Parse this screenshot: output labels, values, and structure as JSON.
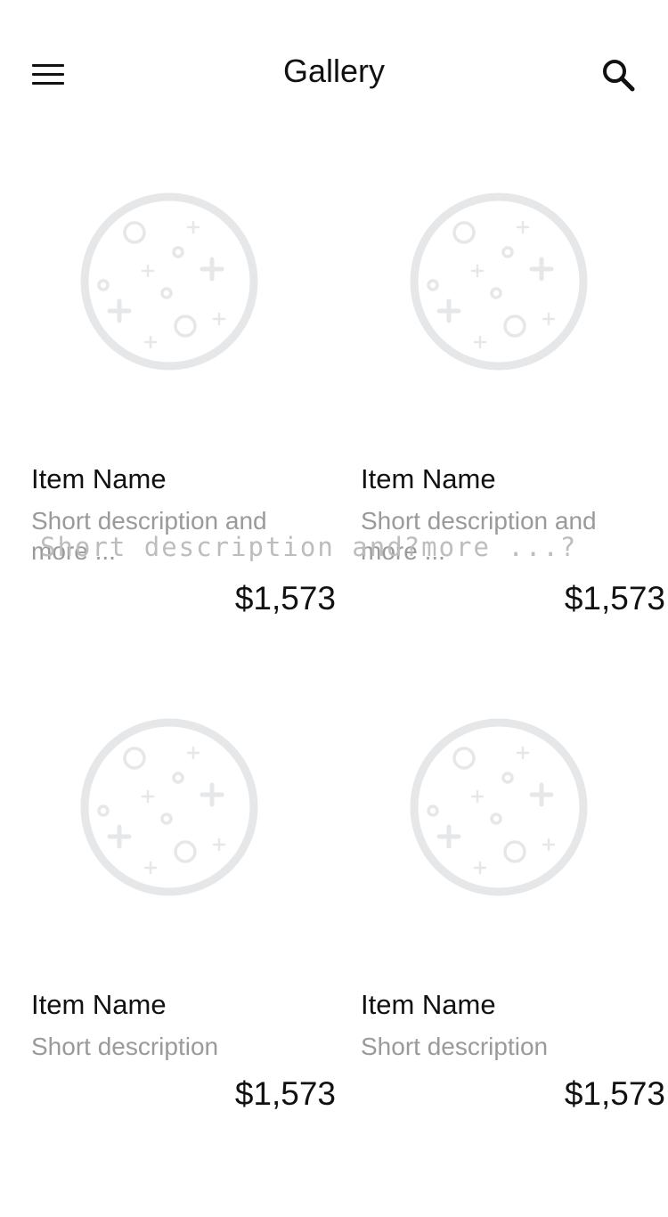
{
  "header": {
    "title": "Gallery",
    "menu_icon": "hamburger-menu-icon",
    "search_icon": "search-icon"
  },
  "colors": {
    "placeholder_gray": "#e6e7e9",
    "description_gray": "#9a9a9a",
    "text": "#111111"
  },
  "items": [
    {
      "name": "Item Name",
      "description": "Short description and more ...",
      "price": "$1,573",
      "image_icon": "image-placeholder-icon"
    },
    {
      "name": "Item Name",
      "description": "Short description and more ...",
      "price": "$1,573",
      "image_icon": "image-placeholder-icon"
    },
    {
      "name": "Item Name",
      "description": "Short description",
      "price": "$1,573",
      "image_icon": "image-placeholder-icon"
    },
    {
      "name": "Item Name",
      "description": "Short description",
      "price": "$1,573",
      "image_icon": "image-placeholder-icon"
    }
  ],
  "overlay": {
    "text": "Short description and?more ...?"
  }
}
